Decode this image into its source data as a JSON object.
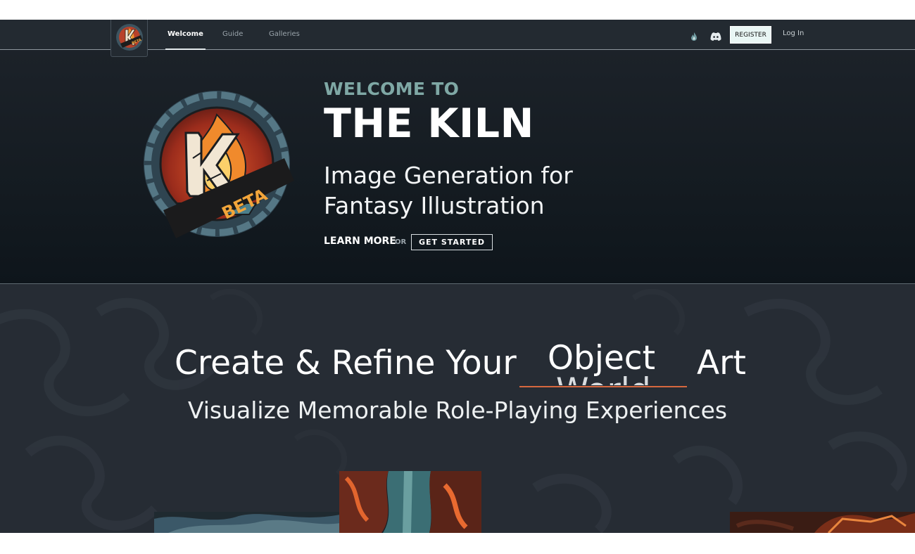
{
  "nav": {
    "logo_icon": "kiln-beta-logo",
    "links": [
      {
        "label": "Welcome",
        "active": true
      },
      {
        "label": "Guide",
        "active": false
      },
      {
        "label": "Galleries",
        "active": false
      }
    ],
    "icons": [
      "flame-icon",
      "discord-icon"
    ],
    "register_label": "REGISTER",
    "login_label": "Log In"
  },
  "hero": {
    "badge_text": "BETA",
    "kicker": "WELCOME TO",
    "title": "THE KILN",
    "subtitle": "Image Generation for Fantasy Illustration",
    "learn_more": "LEARN MORE",
    "or": "OR",
    "get_started": "GET STARTED"
  },
  "section": {
    "heading_prefix": "Create & Refine Your",
    "rotating_word": "Object",
    "rotating_word_next": "World",
    "heading_suffix": "Art",
    "tagline": "Visualize Memorable Role-Playing Experiences"
  },
  "colors": {
    "nav_bg": "#232a31",
    "accent_teal": "#7fa8a5",
    "accent_orange": "#d7683f",
    "section_bg": "#262c34"
  }
}
